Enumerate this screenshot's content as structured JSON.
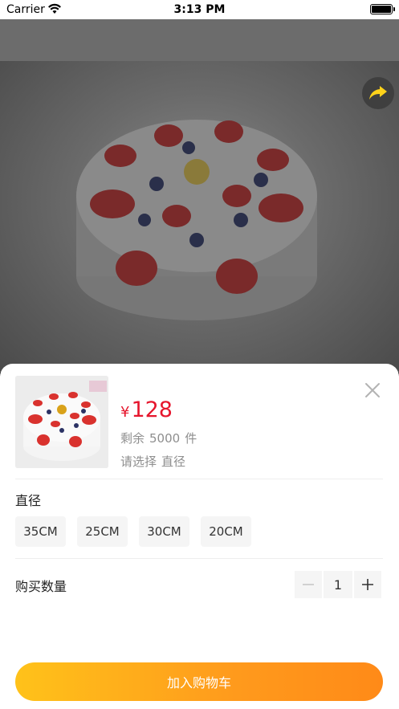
{
  "status_bar": {
    "carrier": "Carrier",
    "time": "3:13 PM"
  },
  "product": {
    "share_icon": "share-arrow-icon"
  },
  "sheet": {
    "price": {
      "currency": "¥",
      "amount": "128"
    },
    "stock": {
      "label": "剩余",
      "count": "5000",
      "unit": "件"
    },
    "select_hint": {
      "label": "请选择",
      "spec": "直径"
    },
    "spec_group": {
      "title": "直径",
      "options": [
        "35CM",
        "25CM",
        "30CM",
        "20CM"
      ]
    },
    "quantity": {
      "label": "购买数量",
      "value": "1"
    },
    "add_to_cart": "加入购物车",
    "colors": {
      "price": "#e6162d",
      "button_start": "#ffc21a",
      "button_end": "#ff8a18"
    }
  }
}
